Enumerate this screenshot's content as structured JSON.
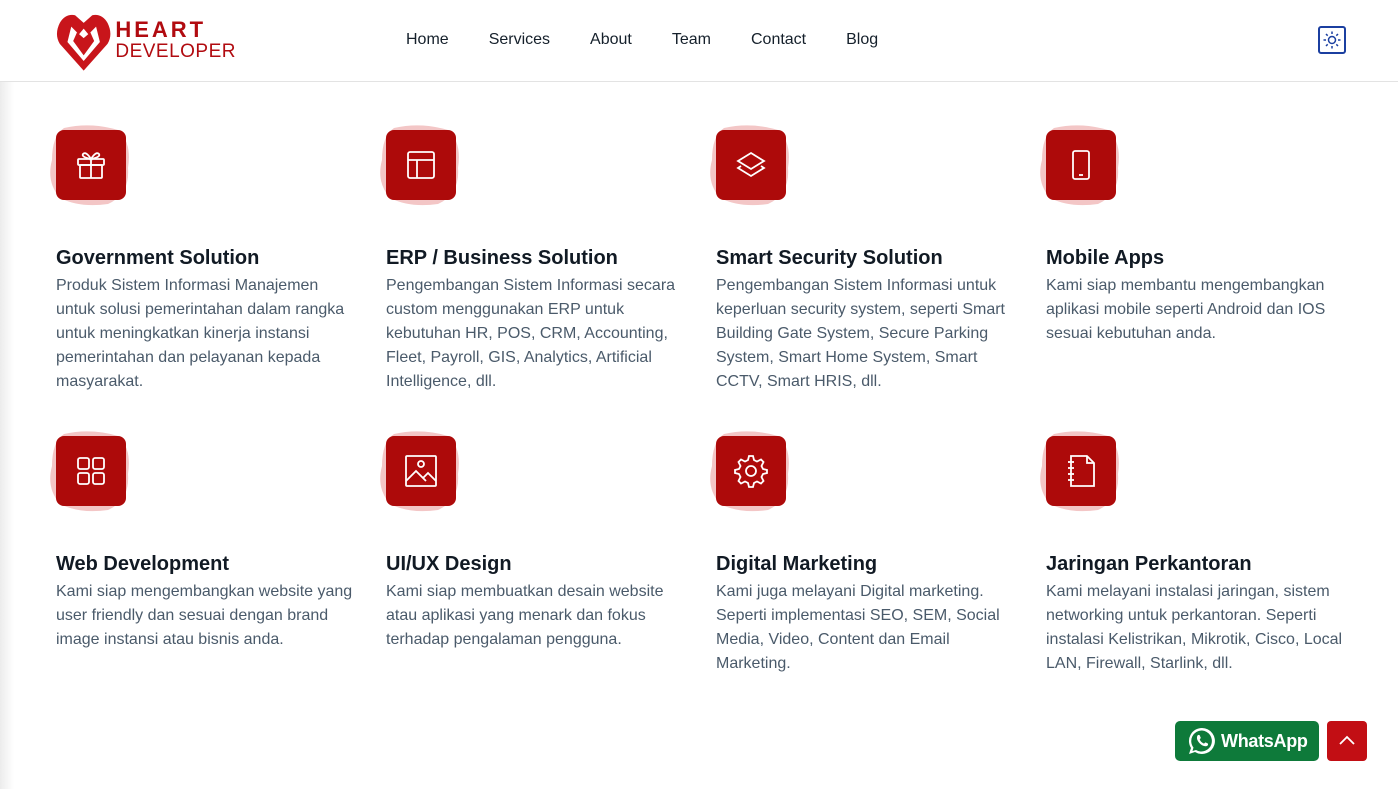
{
  "brand": {
    "line1": "HEART",
    "line2": "DEVELOPER",
    "accent": "#ad0a0a",
    "mark_icon": "heart-shield-logo"
  },
  "nav": [
    {
      "label": "Home"
    },
    {
      "label": "Services"
    },
    {
      "label": "About"
    },
    {
      "label": "Team"
    },
    {
      "label": "Contact"
    },
    {
      "label": "Blog"
    }
  ],
  "theme_toggle": {
    "icon": "sun-icon"
  },
  "services": [
    {
      "icon": "gift-icon",
      "title": "Government Solution",
      "desc": "Produk Sistem Informasi Manajemen untuk solusi pemerintahan dalam rangka untuk meningkatkan kinerja instansi pemerintahan dan pelayanan kepada masyarakat."
    },
    {
      "icon": "layout-icon",
      "title": "ERP / Business Solution",
      "desc": "Pengembangan Sistem Informasi secara custom menggunakan ERP untuk kebutuhan HR, POS, CRM, Accounting, Fleet, Payroll, GIS, Analytics, Artificial Intelligence, dll."
    },
    {
      "icon": "layers-icon",
      "title": "Smart Security Solution",
      "desc": "Pengembangan Sistem Informasi untuk keperluan security system, seperti Smart Building Gate System, Secure Parking System, Smart Home System, Smart CCTV, Smart HRIS, dll."
    },
    {
      "icon": "tablet-icon",
      "title": "Mobile Apps",
      "desc": "Kami siap membantu mengembangkan aplikasi mobile seperti Android dan IOS sesuai kebutuhan anda."
    },
    {
      "icon": "grid-icon",
      "title": "Web Development",
      "desc": "Kami siap mengembangkan website yang user friendly dan sesuai dengan brand image instansi atau bisnis anda."
    },
    {
      "icon": "image-icon",
      "title": "UI/UX Design",
      "desc": "Kami siap membuatkan desain website atau aplikasi yang menark dan fokus terhadap pengalaman pengguna."
    },
    {
      "icon": "gear-icon",
      "title": "Digital Marketing",
      "desc": "Kami juga melayani Digital marketing. Seperti implementasi SEO, SEM, Social Media, Video, Content dan Email Marketing."
    },
    {
      "icon": "journal-icon",
      "title": "Jaringan Perkantoran",
      "desc": "Kami melayani instalasi jaringan, sistem networking untuk perkantoran. Seperti instalasi Kelistrikan, Mikrotik, Cisco, Local LAN, Firewall, Starlink, dll."
    }
  ],
  "whatsapp": {
    "label": "WhatsApp",
    "color": "#0e7a3a",
    "icon": "whatsapp-icon"
  },
  "back_to_top": {
    "icon": "chevron-up-icon",
    "color": "#c20e14"
  }
}
